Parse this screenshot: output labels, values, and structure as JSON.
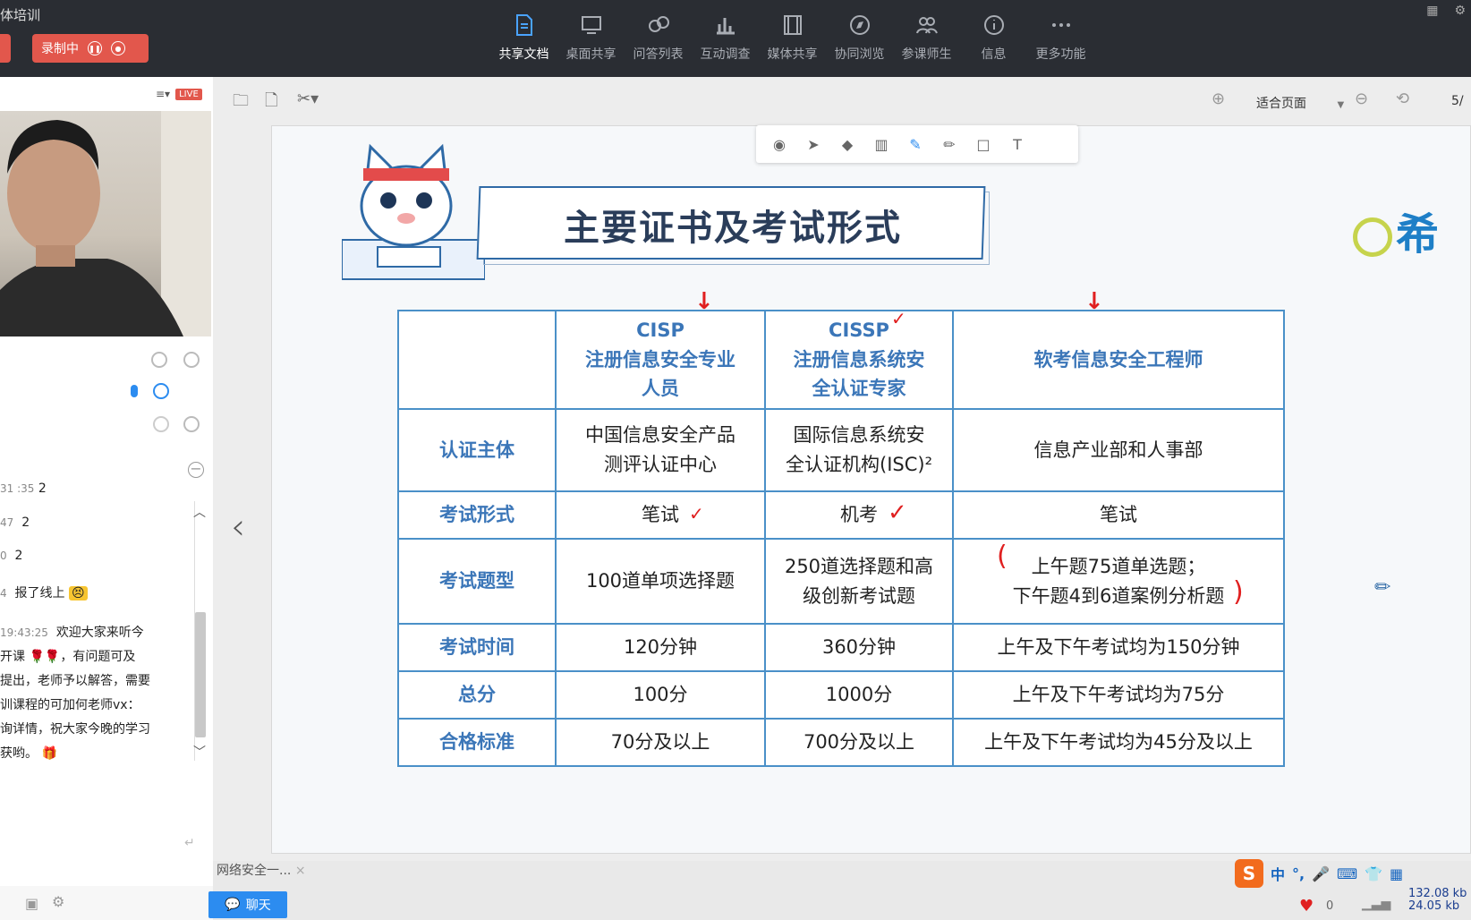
{
  "app": {
    "title": "体培训",
    "recording_label": "录制中"
  },
  "toolbar": {
    "items": [
      {
        "label": "共享文档",
        "icon": "document-share-icon",
        "active": true
      },
      {
        "label": "桌面共享",
        "icon": "desktop-share-icon"
      },
      {
        "label": "问答列表",
        "icon": "qa-list-icon"
      },
      {
        "label": "互动调查",
        "icon": "survey-chart-icon"
      },
      {
        "label": "媒体共享",
        "icon": "media-film-icon"
      },
      {
        "label": "协同浏览",
        "icon": "compass-icon"
      },
      {
        "label": "参课师生",
        "icon": "participants-icon"
      },
      {
        "label": "信息",
        "icon": "info-icon"
      },
      {
        "label": "更多功能",
        "icon": "more-dots-icon"
      }
    ]
  },
  "sidebar": {
    "live_badge": "LIVE",
    "chat": [
      {
        "time": "31 :35",
        "text": "2"
      },
      {
        "time": "47",
        "text": "2"
      },
      {
        "time": "0",
        "text": "2"
      },
      {
        "time": "4",
        "text": "报了线上"
      },
      {
        "time": "19:43:25",
        "text": "欢迎大家来听今"
      },
      {
        "time": "",
        "text": "开课"
      },
      {
        "time": "",
        "text": "，有问题可及"
      },
      {
        "time": "",
        "text": "提出，老师予以解答，需要"
      },
      {
        "time": "",
        "text": "训课程的可加何老师vx："
      },
      {
        "time": "",
        "text": "询详情，祝大家今晚的学习"
      },
      {
        "time": "",
        "text": "获哟。"
      }
    ],
    "chat_button": "聊天",
    "doc_tab": "网络安全一..."
  },
  "doc_toolbar": {
    "fit_label": "适合页面",
    "page": "5/"
  },
  "slide": {
    "title": "主要证书及考试形式",
    "logo_text": "希",
    "table": {
      "headers": [
        "",
        "CISP\n注册信息安全专业\n人员",
        "CISSP\n注册信息系统安\n全认证专家",
        "软考信息安全工程师"
      ],
      "rows": [
        {
          "label": "认证主体",
          "cells": [
            "中国信息安全产品\n测评认证中心",
            "国际信息系统安\n全认证机构(ISC)²",
            "信息产业部和人事部"
          ]
        },
        {
          "label": "考试形式",
          "cells": [
            "笔试",
            "机考",
            "笔试"
          ]
        },
        {
          "label": "考试题型",
          "cells": [
            "100道单项选择题",
            "250道选择题和高\n级创新考试题",
            "上午题75道单选题；\n下午题4到6道案例分析题"
          ]
        },
        {
          "label": "考试时间",
          "cells": [
            "120分钟",
            "360分钟",
            "上午及下午考试均为150分钟"
          ]
        },
        {
          "label": "总分",
          "cells": [
            "100分",
            "1000分",
            "上午及下午考试均为75分"
          ]
        },
        {
          "label": "合格标准",
          "cells": [
            "70分及以上",
            "700分及以上",
            "上午及下午考试均为45分及以上"
          ]
        }
      ]
    }
  },
  "tray": {
    "ime": "中",
    "heart_count": "0",
    "net_up": "132.08 kb",
    "net_down": "24.05 kb"
  },
  "colors": {
    "accent": "#2c8cf0",
    "record_red": "#e2574c",
    "table_border": "#4a90c8",
    "header_blue": "#3b76b8"
  }
}
